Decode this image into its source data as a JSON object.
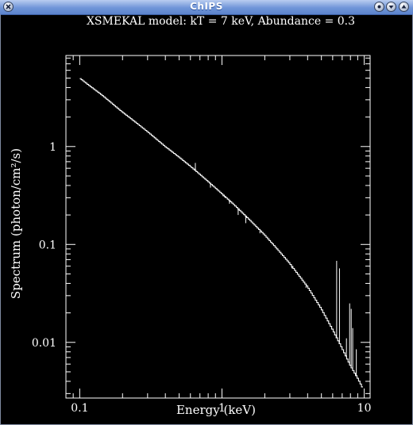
{
  "window": {
    "title": "ChIPS",
    "buttons": [
      "close-icon",
      "minimize-icon",
      "shade-icon",
      "maximize-icon"
    ]
  },
  "chart_data": {
    "type": "line",
    "title": "XSMEKAL model: kT = 7 keV, Abundance = 0.3",
    "xlabel": "Energy (keV)",
    "ylabel": "Spectrum (photon/cm²/s)",
    "xscale": "log",
    "yscale": "log",
    "xlim": [
      0.08,
      11
    ],
    "ylim": [
      0.0027,
      8.5
    ],
    "x_ticks": [
      0.1,
      1,
      10
    ],
    "x_tick_labels": [
      "0.1",
      "1",
      "10"
    ],
    "y_ticks": [
      0.01,
      0.1,
      1
    ],
    "y_tick_labels": [
      "0.01",
      "0.1",
      "1"
    ],
    "grid": false,
    "legend": "none",
    "colors": {
      "background": "#000000",
      "line": "#ffffff"
    },
    "series": [
      {
        "continuum": [
          [
            0.1,
            5.0
          ],
          [
            0.11,
            4.5
          ],
          [
            0.125,
            3.9
          ],
          [
            0.14,
            3.45
          ],
          [
            0.16,
            2.95
          ],
          [
            0.18,
            2.55
          ],
          [
            0.2,
            2.25
          ],
          [
            0.25,
            1.75
          ],
          [
            0.3,
            1.42
          ],
          [
            0.4,
            1.0
          ],
          [
            0.5,
            0.78
          ],
          [
            0.6,
            0.63
          ],
          [
            0.7,
            0.52
          ],
          [
            0.8,
            0.44
          ],
          [
            1.0,
            0.33
          ],
          [
            1.2,
            0.26
          ],
          [
            1.5,
            0.19
          ],
          [
            2.0,
            0.125
          ],
          [
            2.5,
            0.087
          ],
          [
            3.0,
            0.064
          ],
          [
            4.0,
            0.037
          ],
          [
            5.0,
            0.022
          ],
          [
            6.0,
            0.0135
          ],
          [
            7.0,
            0.0087
          ],
          [
            8.0,
            0.0058
          ],
          [
            9.0,
            0.0043
          ],
          [
            9.8,
            0.0034
          ]
        ],
        "lines": [
          [
            0.65,
            0.68
          ],
          [
            0.83,
            0.38
          ],
          [
            1.02,
            0.31
          ],
          [
            1.05,
            0.3
          ],
          [
            1.1,
            0.29
          ],
          [
            1.13,
            0.26
          ],
          [
            1.17,
            0.27
          ],
          [
            1.3,
            0.2
          ],
          [
            1.47,
            0.165
          ],
          [
            1.85,
            0.13
          ],
          [
            2.45,
            0.091
          ],
          [
            3.1,
            0.057
          ],
          [
            3.9,
            0.036
          ],
          [
            6.4,
            0.068
          ],
          [
            6.7,
            0.057
          ],
          [
            7.5,
            0.011
          ],
          [
            7.9,
            0.025
          ],
          [
            8.1,
            0.022
          ],
          [
            8.3,
            0.014
          ],
          [
            8.8,
            0.0085
          ]
        ]
      }
    ]
  }
}
